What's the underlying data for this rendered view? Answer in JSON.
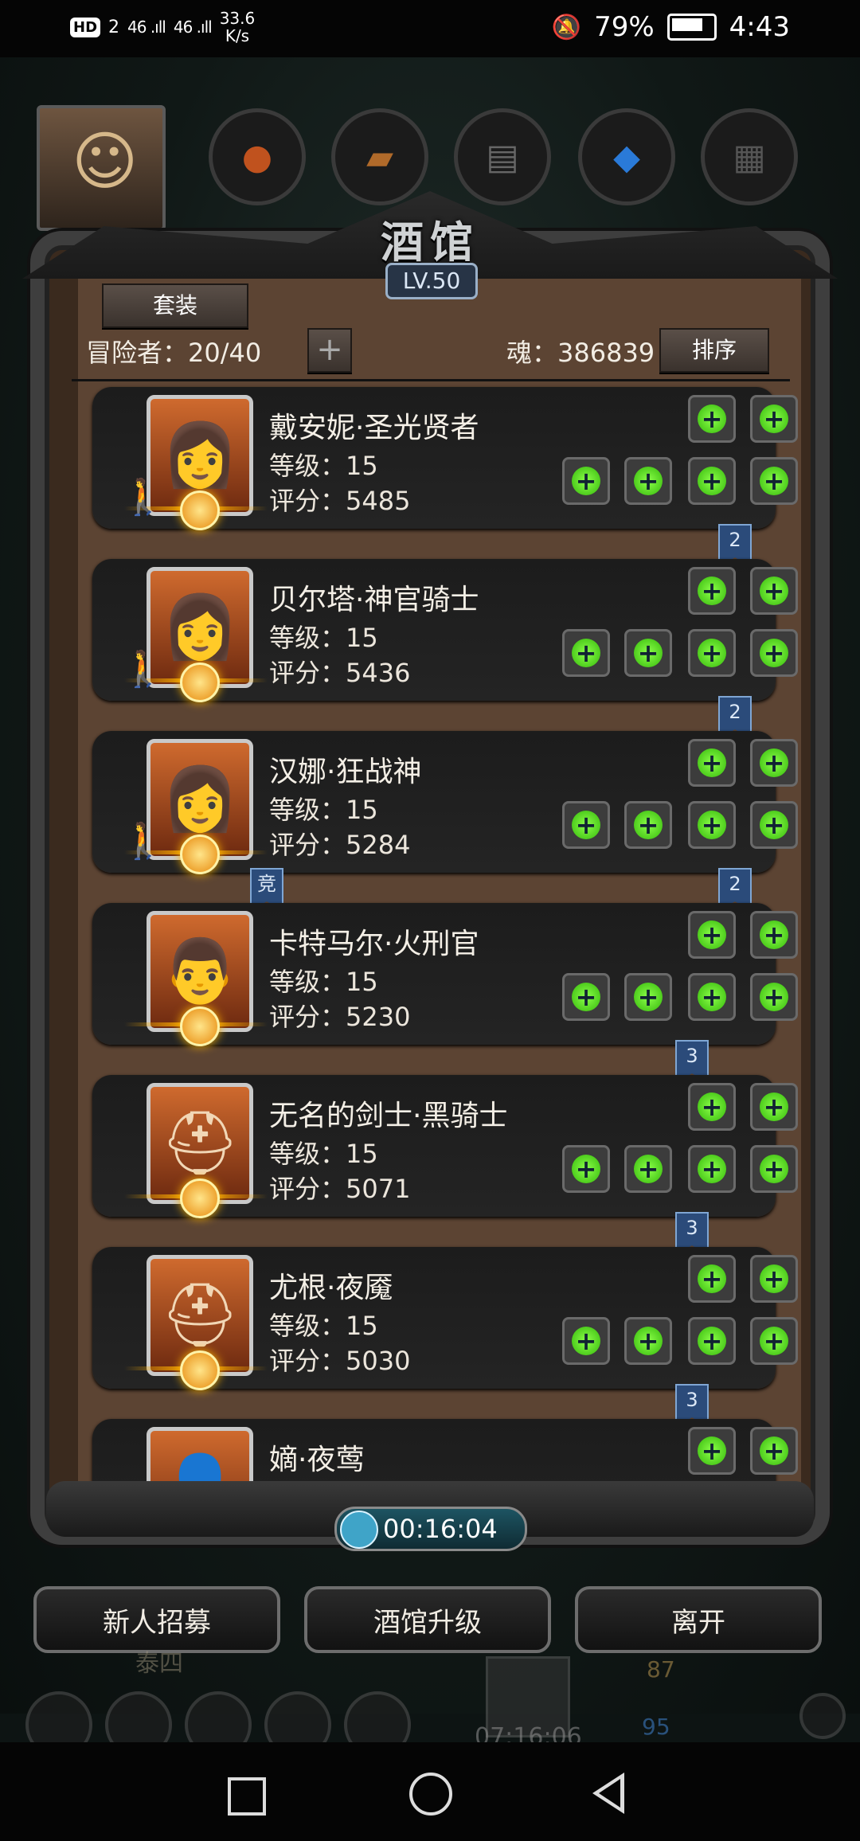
{
  "status_bar": {
    "hd": "HD",
    "sim": "2",
    "signal1": "46 .ıll",
    "signal2": "46 .ıll",
    "speed": "33.6",
    "speed_unit": "K/s",
    "battery": "79%",
    "time": "4:43"
  },
  "panel": {
    "title": "酒馆",
    "level": "LV.50",
    "suit_button": "套装",
    "adventurer_label": "冒险者：20/40",
    "add_button": "+",
    "soul_label": "魂：386839",
    "sort_button": "排序"
  },
  "heroes": [
    {
      "name": "戴安妮·圣光贤者",
      "level": "等级：15",
      "score": "评分：5485",
      "rank": "2",
      "walker": true
    },
    {
      "name": "贝尔塔·神官骑士",
      "level": "等级：15",
      "score": "评分：5436",
      "rank": "2",
      "walker": true
    },
    {
      "name": "汉娜·狂战神",
      "level": "等级：15",
      "score": "评分：5284",
      "rank": "2",
      "walker": true,
      "tag": "竞"
    },
    {
      "name": "卡特马尔·火刑官",
      "level": "等级：15",
      "score": "评分：5230",
      "rank": "3",
      "walker": false
    },
    {
      "name": "无名的剑士·黑骑士",
      "level": "等级：15",
      "score": "评分：5071",
      "rank": "3",
      "walker": false
    },
    {
      "name": "尤根·夜魇",
      "level": "等级：15",
      "score": "评分：5030",
      "rank": "3",
      "walker": false
    },
    {
      "name": "嫡·夜莺",
      "level": "",
      "score": "",
      "rank": "",
      "walker": false
    }
  ],
  "timer": "00:16:04",
  "buttons": {
    "recruit": "新人招募",
    "upgrade": "酒馆升级",
    "leave": "离开"
  },
  "hud": {
    "name": "泰四",
    "gold": "87",
    "gems": "95",
    "gift_time": "07:16:06"
  },
  "colors": {
    "accent_green": "#5fe022",
    "panel_brown": "#5c4433",
    "rank_blue": "#2b4b7a"
  }
}
